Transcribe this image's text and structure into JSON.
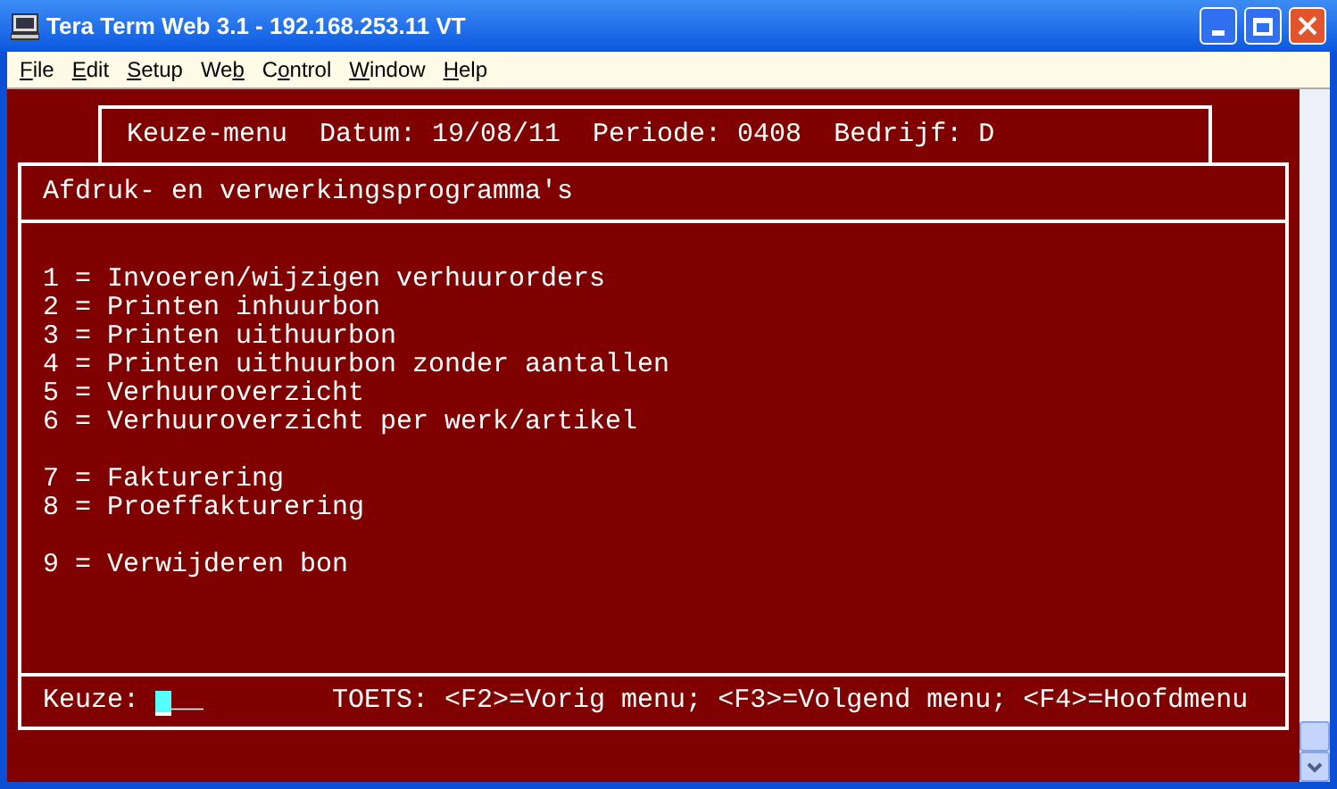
{
  "window": {
    "title": "Tera Term Web 3.1 - 192.168.253.11 VT"
  },
  "menu": [
    {
      "hotkey": "F",
      "after": "ile"
    },
    {
      "hotkey": "E",
      "after": "dit"
    },
    {
      "hotkey": "S",
      "after": "etup"
    },
    {
      "before": "We",
      "hotkey": "b"
    },
    {
      "before": "C",
      "hotkey": "o",
      "after": "ntrol"
    },
    {
      "hotkey": "W",
      "after": "indow"
    },
    {
      "hotkey": "H",
      "after": "elp"
    }
  ],
  "terminal": {
    "header": "Keuze-menu  Datum: 19/08/11  Periode: 0408  Bedrijf: D",
    "title": "Afdruk- en verwerkingsprogramma's",
    "option_groups": [
      [
        "1 = Invoeren/wijzigen verhuurorders",
        "2 = Printen inhuurbon",
        "3 = Printen uithuurbon",
        "4 = Printen uithuurbon zonder aantallen",
        "5 = Verhuuroverzicht",
        "6 = Verhuuroverzicht per werk/artikel"
      ],
      [
        "7 = Fakturering",
        "8 = Proeffakturering"
      ],
      [
        "9 = Verwijderen bon"
      ]
    ],
    "prompt": "Keuze:",
    "field": "__",
    "keys": "TOETS: <F2>=Vorig menu; <F3>=Volgend menu; <F4>=Hoofdmenu"
  }
}
